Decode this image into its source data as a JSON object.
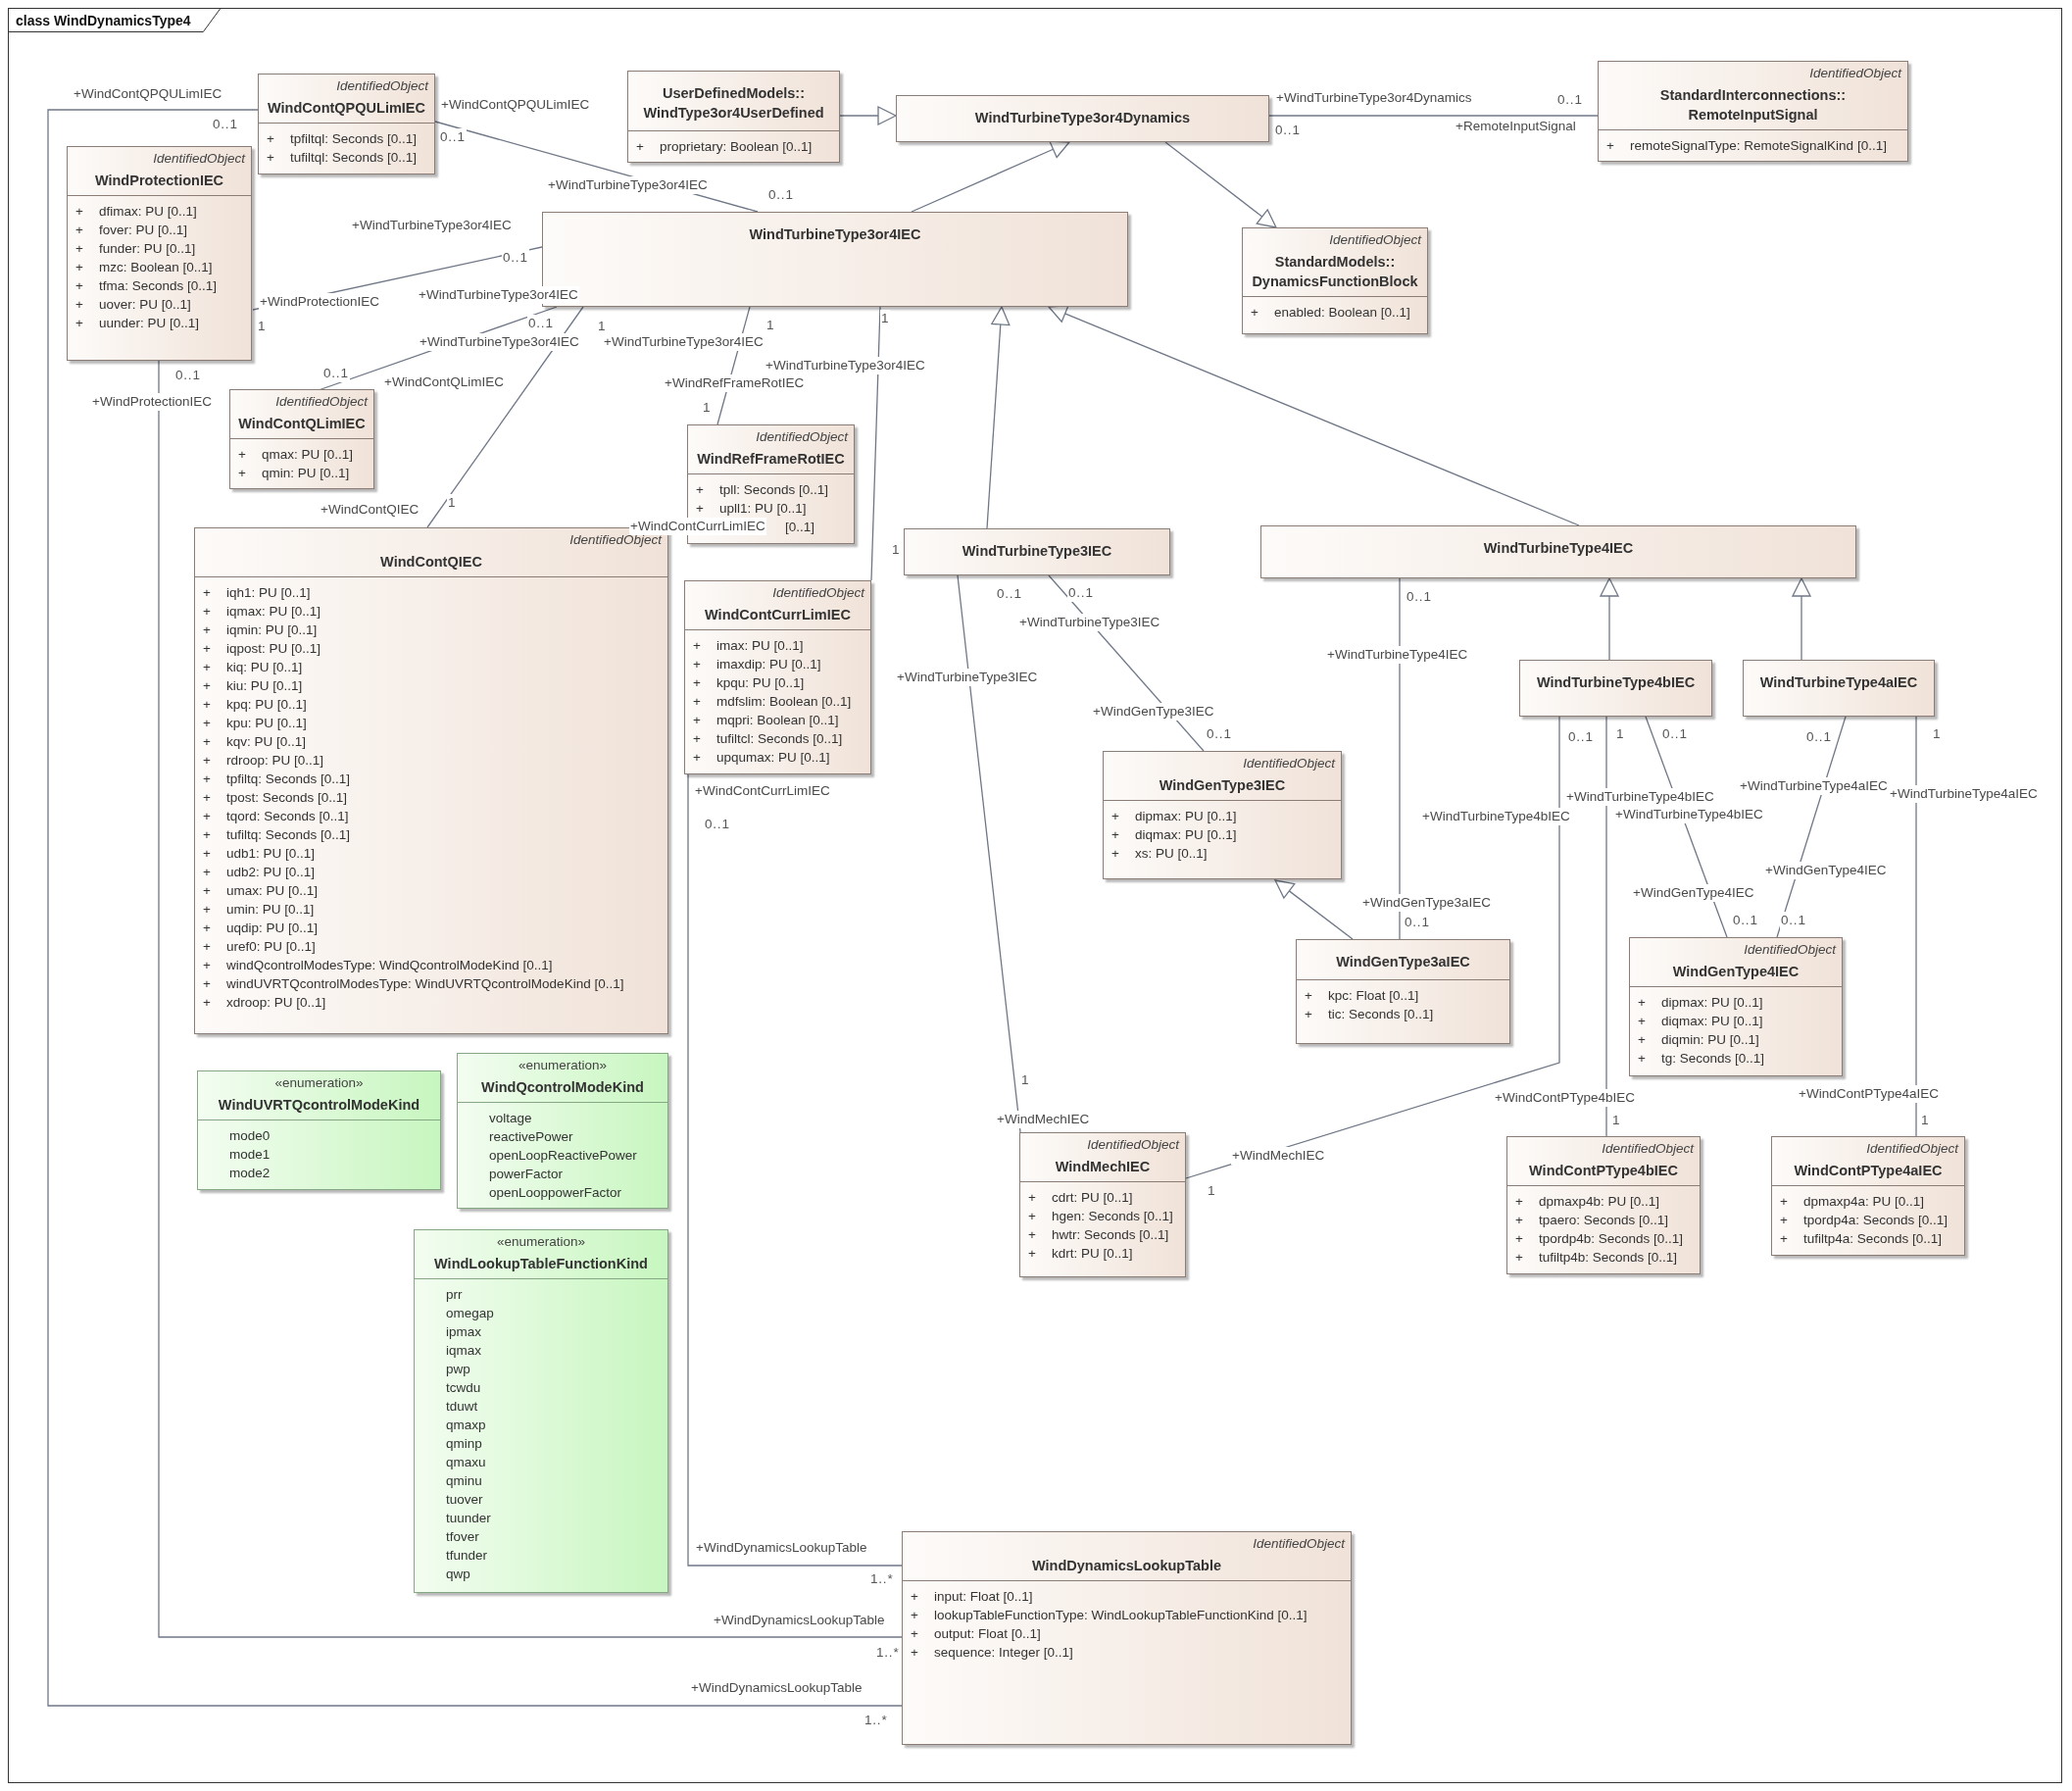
{
  "diagram": {
    "title": "class WindDynamicsType4"
  },
  "classes": [
    {
      "kind": "class",
      "stereotype": "IdentifiedObject",
      "name": "WindContQPQULimIEC",
      "attributes": [
        {
          "visibility": "+",
          "text": "tpfiltql: Seconds [0..1]"
        },
        {
          "visibility": "+",
          "text": "tufiltql: Seconds [0..1]"
        }
      ]
    },
    {
      "kind": "class",
      "stereotype": "IdentifiedObject",
      "name": "WindProtectionIEC",
      "attributes": [
        {
          "visibility": "+",
          "text": "dfimax: PU [0..1]"
        },
        {
          "visibility": "+",
          "text": "fover: PU [0..1]"
        },
        {
          "visibility": "+",
          "text": "funder: PU [0..1]"
        },
        {
          "visibility": "+",
          "text": "mzc: Boolean [0..1]"
        },
        {
          "visibility": "+",
          "text": "tfma: Seconds [0..1]"
        },
        {
          "visibility": "+",
          "text": "uover: PU [0..1]"
        },
        {
          "visibility": "+",
          "text": "uunder: PU [0..1]"
        }
      ]
    },
    {
      "kind": "class",
      "package": "UserDefinedModels::",
      "name": "WindType3or4UserDefined",
      "attributes": [
        {
          "visibility": "+",
          "text": "proprietary: Boolean [0..1]"
        }
      ]
    },
    {
      "kind": "class",
      "name": "WindTurbineType3or4Dynamics"
    },
    {
      "kind": "class",
      "stereotype": "IdentifiedObject",
      "package": "StandardInterconnections::",
      "name": "RemoteInputSignal",
      "attributes": [
        {
          "visibility": "+",
          "text": "remoteSignalType: RemoteSignalKind [0..1]"
        }
      ]
    },
    {
      "kind": "class",
      "name": "WindTurbineType3or4IEC"
    },
    {
      "kind": "class",
      "stereotype": "IdentifiedObject",
      "package": "StandardModels::",
      "name": "DynamicsFunctionBlock",
      "attributes": [
        {
          "visibility": "+",
          "text": "enabled: Boolean [0..1]"
        }
      ]
    },
    {
      "kind": "class",
      "stereotype": "IdentifiedObject",
      "name": "WindContQLimIEC",
      "attributes": [
        {
          "visibility": "+",
          "text": "qmax: PU [0..1]"
        },
        {
          "visibility": "+",
          "text": "qmin: PU [0..1]"
        }
      ]
    },
    {
      "kind": "class",
      "stereotype": "IdentifiedObject",
      "name": "WindRefFrameRotIEC",
      "attributes": [
        {
          "visibility": "+",
          "text": "tpll: Seconds [0..1]"
        },
        {
          "visibility": "+",
          "text": "upll1: PU [0..1]"
        },
        {
          "text": "[0..1]"
        }
      ]
    },
    {
      "kind": "class",
      "stereotype": "IdentifiedObject",
      "name": "WindContQIEC",
      "attributes": [
        {
          "visibility": "+",
          "text": "iqh1: PU [0..1]"
        },
        {
          "visibility": "+",
          "text": "iqmax: PU [0..1]"
        },
        {
          "visibility": "+",
          "text": "iqmin: PU [0..1]"
        },
        {
          "visibility": "+",
          "text": "iqpost: PU [0..1]"
        },
        {
          "visibility": "+",
          "text": "kiq: PU [0..1]"
        },
        {
          "visibility": "+",
          "text": "kiu: PU [0..1]"
        },
        {
          "visibility": "+",
          "text": "kpq: PU [0..1]"
        },
        {
          "visibility": "+",
          "text": "kpu: PU [0..1]"
        },
        {
          "visibility": "+",
          "text": "kqv: PU [0..1]"
        },
        {
          "visibility": "+",
          "text": "rdroop: PU [0..1]"
        },
        {
          "visibility": "+",
          "text": "tpfiltq: Seconds [0..1]"
        },
        {
          "visibility": "+",
          "text": "tpost: Seconds [0..1]"
        },
        {
          "visibility": "+",
          "text": "tqord: Seconds [0..1]"
        },
        {
          "visibility": "+",
          "text": "tufiltq: Seconds [0..1]"
        },
        {
          "visibility": "+",
          "text": "udb1: PU [0..1]"
        },
        {
          "visibility": "+",
          "text": "udb2: PU [0..1]"
        },
        {
          "visibility": "+",
          "text": "umax: PU [0..1]"
        },
        {
          "visibility": "+",
          "text": "umin: PU [0..1]"
        },
        {
          "visibility": "+",
          "text": "uqdip: PU [0..1]"
        },
        {
          "visibility": "+",
          "text": "uref0: PU [0..1]"
        },
        {
          "visibility": "+",
          "text": "windQcontrolModesType: WindQcontrolModeKind [0..1]"
        },
        {
          "visibility": "+",
          "text": "windUVRTQcontrolModesType: WindUVRTQcontrolModeKind [0..1]"
        },
        {
          "visibility": "+",
          "text": "xdroop: PU [0..1]"
        }
      ]
    },
    {
      "kind": "class",
      "stereotype": "IdentifiedObject",
      "name": "WindContCurrLimIEC",
      "attributes": [
        {
          "visibility": "+",
          "text": "imax: PU [0..1]"
        },
        {
          "visibility": "+",
          "text": "imaxdip: PU [0..1]"
        },
        {
          "visibility": "+",
          "text": "kpqu: PU [0..1]"
        },
        {
          "visibility": "+",
          "text": "mdfslim: Boolean [0..1]"
        },
        {
          "visibility": "+",
          "text": "mqpri: Boolean [0..1]"
        },
        {
          "visibility": "+",
          "text": "tufiltcl: Seconds [0..1]"
        },
        {
          "visibility": "+",
          "text": "upqumax: PU [0..1]"
        }
      ]
    },
    {
      "kind": "class",
      "name": "WindTurbineType3IEC"
    },
    {
      "kind": "class",
      "name": "WindTurbineType4IEC"
    },
    {
      "kind": "class",
      "name": "WindTurbineType4bIEC"
    },
    {
      "kind": "class",
      "name": "WindTurbineType4aIEC"
    },
    {
      "kind": "class",
      "stereotype": "IdentifiedObject",
      "name": "WindGenType3IEC",
      "attributes": [
        {
          "visibility": "+",
          "text": "dipmax: PU [0..1]"
        },
        {
          "visibility": "+",
          "text": "diqmax: PU [0..1]"
        },
        {
          "visibility": "+",
          "text": "xs: PU [0..1]"
        }
      ]
    },
    {
      "kind": "class",
      "name": "WindGenType3aIEC",
      "attributes": [
        {
          "visibility": "+",
          "text": "kpc: Float [0..1]"
        },
        {
          "visibility": "+",
          "text": "tic: Seconds [0..1]"
        }
      ]
    },
    {
      "kind": "class",
      "stereotype": "IdentifiedObject",
      "name": "WindGenType4IEC",
      "attributes": [
        {
          "visibility": "+",
          "text": "dipmax: PU [0..1]"
        },
        {
          "visibility": "+",
          "text": "diqmax: PU [0..1]"
        },
        {
          "visibility": "+",
          "text": "diqmin: PU [0..1]"
        },
        {
          "visibility": "+",
          "text": "tg: Seconds [0..1]"
        }
      ]
    },
    {
      "kind": "class",
      "stereotype": "IdentifiedObject",
      "name": "WindMechIEC",
      "attributes": [
        {
          "visibility": "+",
          "text": "cdrt: PU [0..1]"
        },
        {
          "visibility": "+",
          "text": "hgen: Seconds [0..1]"
        },
        {
          "visibility": "+",
          "text": "hwtr: Seconds [0..1]"
        },
        {
          "visibility": "+",
          "text": "kdrt: PU [0..1]"
        }
      ]
    },
    {
      "kind": "class",
      "stereotype": "IdentifiedObject",
      "name": "WindContPType4bIEC",
      "attributes": [
        {
          "visibility": "+",
          "text": "dpmaxp4b: PU [0..1]"
        },
        {
          "visibility": "+",
          "text": "tpaero: Seconds [0..1]"
        },
        {
          "visibility": "+",
          "text": "tpordp4b: Seconds [0..1]"
        },
        {
          "visibility": "+",
          "text": "tufiltp4b: Seconds [0..1]"
        }
      ]
    },
    {
      "kind": "class",
      "stereotype": "IdentifiedObject",
      "name": "WindContPType4aIEC",
      "attributes": [
        {
          "visibility": "+",
          "text": "dpmaxp4a: PU [0..1]"
        },
        {
          "visibility": "+",
          "text": "tpordp4a: Seconds [0..1]"
        },
        {
          "visibility": "+",
          "text": "tufiltp4a: Seconds [0..1]"
        }
      ]
    },
    {
      "kind": "class",
      "stereotype": "IdentifiedObject",
      "name": "WindDynamicsLookupTable",
      "attributes": [
        {
          "visibility": "+",
          "text": "input: Float [0..1]"
        },
        {
          "visibility": "+",
          "text": "lookupTableFunctionType: WindLookupTableFunctionKind [0..1]"
        },
        {
          "visibility": "+",
          "text": "output: Float [0..1]"
        },
        {
          "visibility": "+",
          "text": "sequence: Integer [0..1]"
        }
      ]
    },
    {
      "kind": "enumeration",
      "stereotype": "«enumeration»",
      "name": "WindUVRTQcontrolModeKind",
      "literals": [
        "mode0",
        "mode1",
        "mode2"
      ]
    },
    {
      "kind": "enumeration",
      "stereotype": "«enumeration»",
      "name": "WindQcontrolModeKind",
      "literals": [
        "voltage",
        "reactivePower",
        "openLoopReactivePower",
        "powerFactor",
        "openLooppowerFactor"
      ]
    },
    {
      "kind": "enumeration",
      "stereotype": "«enumeration»",
      "name": "WindLookupTableFunctionKind",
      "literals": [
        "prr",
        "omegap",
        "ipmax",
        "iqmax",
        "pwp",
        "tcwdu",
        "tduwt",
        "qmaxp",
        "qminp",
        "qmaxu",
        "qminu",
        "tuover",
        "tuunder",
        "tfover",
        "tfunder",
        "qwp"
      ]
    }
  ],
  "connector_labels": [
    {
      "kind": "role",
      "text": "+WindContQPQULimIEC"
    },
    {
      "kind": "multiplicity",
      "text": "0..1"
    },
    {
      "kind": "role",
      "text": "+WindContQPQULimIEC"
    },
    {
      "kind": "multiplicity",
      "text": "0..1"
    },
    {
      "kind": "role",
      "text": "+WindTurbineType3or4Dynamics"
    },
    {
      "kind": "multiplicity",
      "text": "0..1"
    },
    {
      "kind": "multiplicity",
      "text": "0..1"
    },
    {
      "kind": "role",
      "text": "+RemoteInputSignal"
    },
    {
      "kind": "role",
      "text": "+WindTurbineType3or4IEC"
    },
    {
      "kind": "multiplicity",
      "text": "0..1"
    },
    {
      "kind": "role",
      "text": "+WindTurbineType3or4IEC"
    },
    {
      "kind": "multiplicity",
      "text": "0..1"
    },
    {
      "kind": "role",
      "text": "+WindTurbineType3or4IEC"
    },
    {
      "kind": "role",
      "text": "+WindProtectionIEC"
    },
    {
      "kind": "multiplicity",
      "text": "1"
    },
    {
      "kind": "multiplicity",
      "text": "0..1"
    },
    {
      "kind": "multiplicity",
      "text": "1"
    },
    {
      "kind": "multiplicity",
      "text": "1"
    },
    {
      "kind": "multiplicity",
      "text": "1"
    },
    {
      "kind": "role",
      "text": "+WindTurbineType3or4IEC"
    },
    {
      "kind": "role",
      "text": "+WindTurbineType3or4IEC"
    },
    {
      "kind": "role",
      "text": "+WindTurbineType3or4IEC"
    },
    {
      "kind": "multiplicity",
      "text": "0..1"
    },
    {
      "kind": "multiplicity",
      "text": "0..1"
    },
    {
      "kind": "role",
      "text": "+WindContQLimIEC"
    },
    {
      "kind": "role",
      "text": "+WindRefFrameRotIEC"
    },
    {
      "kind": "role",
      "text": "+WindProtectionIEC"
    },
    {
      "kind": "multiplicity",
      "text": "1"
    },
    {
      "kind": "multiplicity",
      "text": "1"
    },
    {
      "kind": "role",
      "text": "+WindContQIEC"
    },
    {
      "kind": "role",
      "text": "+WindContCurrLimIEC"
    },
    {
      "kind": "multiplicity",
      "text": "1"
    },
    {
      "kind": "multiplicity",
      "text": "0..1"
    },
    {
      "kind": "multiplicity",
      "text": "0..1"
    },
    {
      "kind": "multiplicity",
      "text": "0..1"
    },
    {
      "kind": "role",
      "text": "+WindTurbineType3IEC"
    },
    {
      "kind": "role",
      "text": "+WindTurbineType4IEC"
    },
    {
      "kind": "role",
      "text": "+WindTurbineType3IEC"
    },
    {
      "kind": "role",
      "text": "+WindGenType3IEC"
    },
    {
      "kind": "multiplicity",
      "text": "0..1"
    },
    {
      "kind": "multiplicity",
      "text": "0..1"
    },
    {
      "kind": "multiplicity",
      "text": "1"
    },
    {
      "kind": "multiplicity",
      "text": "0..1"
    },
    {
      "kind": "multiplicity",
      "text": "0..1"
    },
    {
      "kind": "multiplicity",
      "text": "1"
    },
    {
      "kind": "role",
      "text": "+WindTurbineType4bIEC"
    },
    {
      "kind": "role",
      "text": "+WindTurbineType4aIEC"
    },
    {
      "kind": "role",
      "text": "+WindTurbineType4aIEC"
    },
    {
      "kind": "role",
      "text": "+WindTurbineType4bIEC"
    },
    {
      "kind": "role",
      "text": "+WindTurbineType4bIEC"
    },
    {
      "kind": "role",
      "text": "+WindContCurrLimIEC"
    },
    {
      "kind": "multiplicity",
      "text": "0..1"
    },
    {
      "kind": "role",
      "text": "+WindGenType4IEC"
    },
    {
      "kind": "role",
      "text": "+WindGenType4IEC"
    },
    {
      "kind": "role",
      "text": "+WindGenType3aIEC"
    },
    {
      "kind": "multiplicity",
      "text": "0..1"
    },
    {
      "kind": "multiplicity",
      "text": "0..1"
    },
    {
      "kind": "multiplicity",
      "text": "0..1"
    },
    {
      "kind": "multiplicity",
      "text": "1"
    },
    {
      "kind": "role",
      "text": "+WindContPType4bIEC"
    },
    {
      "kind": "role",
      "text": "+WindContPType4aIEC"
    },
    {
      "kind": "role",
      "text": "+WindMechIEC"
    },
    {
      "kind": "multiplicity",
      "text": "1"
    },
    {
      "kind": "multiplicity",
      "text": "1"
    },
    {
      "kind": "role",
      "text": "+WindMechIEC"
    },
    {
      "kind": "multiplicity",
      "text": "1"
    },
    {
      "kind": "role",
      "text": "+WindDynamicsLookupTable"
    },
    {
      "kind": "multiplicity",
      "text": "1..*"
    },
    {
      "kind": "role",
      "text": "+WindDynamicsLookupTable"
    },
    {
      "kind": "multiplicity",
      "text": "1..*"
    },
    {
      "kind": "role",
      "text": "+WindDynamicsLookupTable"
    },
    {
      "kind": "multiplicity",
      "text": "1..*"
    }
  ]
}
